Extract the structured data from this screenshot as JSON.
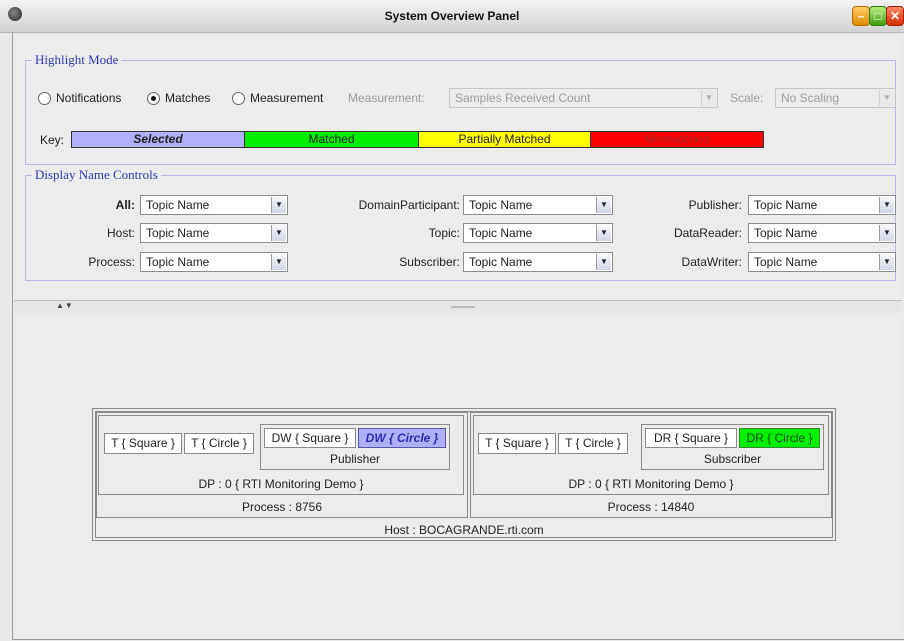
{
  "window": {
    "title": "System Overview Panel",
    "icon": "app-globe-icon"
  },
  "highlight": {
    "legend": "Highlight Mode",
    "modes": [
      {
        "label": "Notifications",
        "selected": false
      },
      {
        "label": "Matches",
        "selected": true
      },
      {
        "label": "Measurement",
        "selected": false
      }
    ],
    "measurement_label": "Measurement:",
    "measurement_value": "Samples Received Count",
    "scale_label": "Scale:",
    "scale_value": "No Scaling",
    "key_label": "Key:",
    "keys": [
      {
        "label": "Selected",
        "color": "#b0b0f8"
      },
      {
        "label": "Matched",
        "color": "#00ee00"
      },
      {
        "label": "Partially Matched",
        "color": "#ffff00"
      },
      {
        "label": "Mismatched",
        "color": "#ff0000"
      }
    ]
  },
  "display": {
    "legend": "Display Name Controls",
    "fields": {
      "all": {
        "label": "All:",
        "value": "Topic Name"
      },
      "host": {
        "label": "Host:",
        "value": "Topic Name"
      },
      "process": {
        "label": "Process:",
        "value": "Topic Name"
      },
      "participant": {
        "label": "DomainParticipant:",
        "value": "Topic Name"
      },
      "topic": {
        "label": "Topic:",
        "value": "Topic Name"
      },
      "subscriber": {
        "label": "Subscriber:",
        "value": "Topic Name"
      },
      "publisher": {
        "label": "Publisher:",
        "value": "Topic Name"
      },
      "datareader": {
        "label": "DataReader:",
        "value": "Topic Name"
      },
      "datawriter": {
        "label": "DataWriter:",
        "value": "Topic Name"
      }
    }
  },
  "diagram": {
    "host": "Host : BOCAGRANDE.rti.com",
    "left": {
      "process": "Process : 8756",
      "participant": "DP : 0 { RTI Monitoring Demo }",
      "topics": [
        "T { Square }",
        "T { Circle }"
      ],
      "entity_caption": "Publisher",
      "entities": [
        "DW { Square }",
        "DW { Circle }"
      ]
    },
    "right": {
      "process": "Process : 14840",
      "participant": "DP : 0 { RTI Monitoring Demo }",
      "topics": [
        "T { Square }",
        "T { Circle }"
      ],
      "entity_caption": "Subscriber",
      "entities": [
        "DR { Square }",
        "DR { Circle }"
      ]
    }
  }
}
